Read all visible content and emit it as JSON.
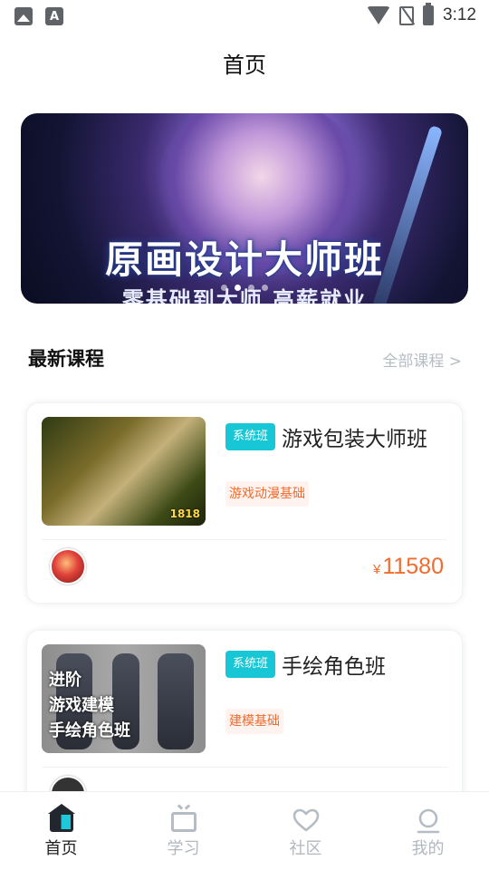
{
  "status_bar": {
    "time": "3:12",
    "left_icons": [
      "image-icon",
      "a-text-icon"
    ],
    "right_icons": [
      "wifi-icon",
      "no-sim-icon",
      "battery-charging-icon"
    ]
  },
  "header": {
    "title": "首页"
  },
  "banner": {
    "title": "原画设计大师班",
    "subtitle": "零基础到大师 高薪就业",
    "dots_count": 4,
    "active_dot": 1
  },
  "section": {
    "title": "最新课程",
    "more": "全部课程 >"
  },
  "courses": [
    {
      "badge": "系统班",
      "name": "游戏包装大师班",
      "category": "游戏动漫基础",
      "price_currency": "¥",
      "price": "11580",
      "thumb_overlay": [
        "",
        "",
        ""
      ],
      "thumb_mark": "1818"
    },
    {
      "badge": "系统班",
      "name": "手绘角色班",
      "category": "建模基础",
      "price_currency": "",
      "price": "",
      "thumb_overlay": [
        "进阶",
        "游戏建模",
        "手绘角色班"
      ],
      "thumb_mark": ""
    }
  ],
  "bottom_nav": [
    {
      "label": "首页",
      "icon": "home-icon",
      "active": true
    },
    {
      "label": "学习",
      "icon": "tv-icon",
      "active": false
    },
    {
      "label": "社区",
      "icon": "heart-icon",
      "active": false
    },
    {
      "label": "我的",
      "icon": "user-icon",
      "active": false
    }
  ],
  "colors": {
    "accent": "#18c7d6",
    "price": "#f06b2c",
    "muted": "#b2b8bf"
  }
}
